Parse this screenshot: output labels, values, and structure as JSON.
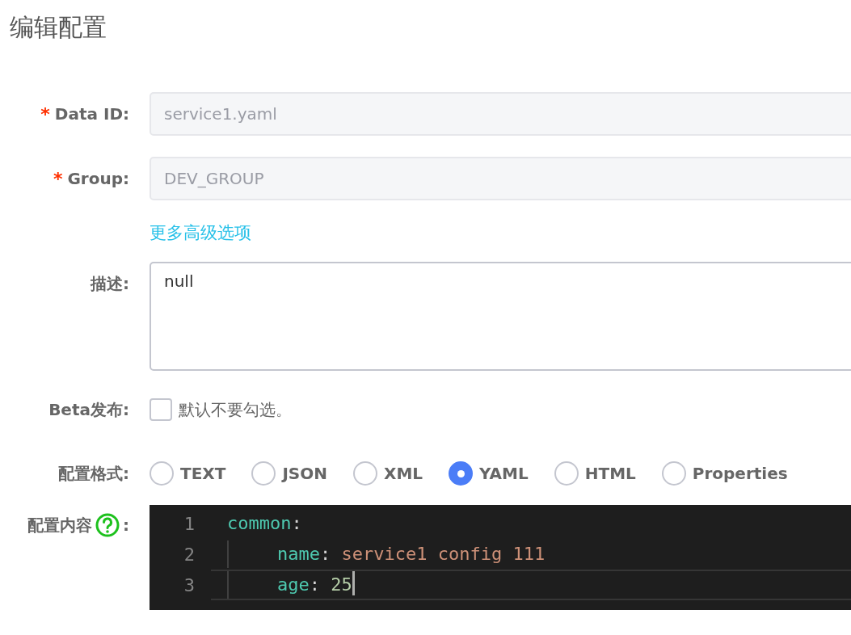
{
  "title": "编辑配置",
  "form": {
    "data_id": {
      "label": "Data ID:",
      "required_mark": "*",
      "value": "service1.yaml",
      "disabled": true
    },
    "group": {
      "label": "Group:",
      "required_mark": "*",
      "value": "DEV_GROUP",
      "disabled": true
    },
    "more_options_link": "更多高级选项",
    "description": {
      "label": "描述:",
      "value": "null"
    },
    "beta": {
      "label": "Beta发布:",
      "checked": false,
      "text": "默认不要勾选。"
    },
    "format": {
      "label": "配置格式:",
      "options": [
        {
          "label": "TEXT",
          "selected": false
        },
        {
          "label": "JSON",
          "selected": false
        },
        {
          "label": "XML",
          "selected": false
        },
        {
          "label": "YAML",
          "selected": true
        },
        {
          "label": "HTML",
          "selected": false
        },
        {
          "label": "Properties",
          "selected": false
        }
      ]
    },
    "content": {
      "label": "配置内容",
      "colon": ":",
      "lines": [
        {
          "number": "1",
          "active": false,
          "cursor": false,
          "tokens": [
            {
              "text": "common",
              "kind": "key"
            },
            {
              "text": ":",
              "kind": "punct"
            }
          ],
          "children": [
            {
              "number": "2",
              "active": false,
              "cursor": false,
              "tokens": [
                {
                  "text": "name",
                  "kind": "key"
                },
                {
                  "text": ": ",
                  "kind": "punct"
                },
                {
                  "text": "service1 config 111",
                  "kind": "string"
                }
              ]
            },
            {
              "number": "3",
              "active": true,
              "cursor": true,
              "tokens": [
                {
                  "text": "age",
                  "kind": "key"
                },
                {
                  "text": ": ",
                  "kind": "punct"
                },
                {
                  "text": "25",
                  "kind": "number"
                }
              ]
            }
          ]
        }
      ]
    }
  }
}
